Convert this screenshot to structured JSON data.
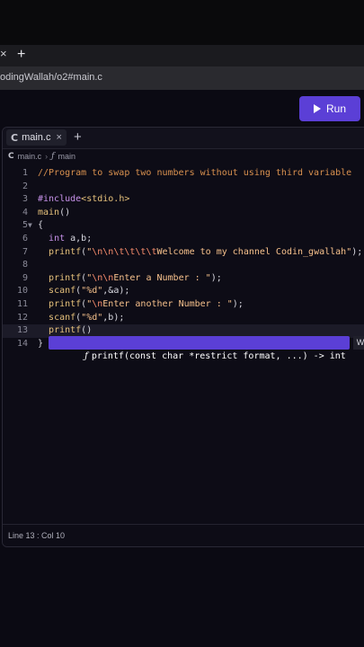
{
  "browser": {
    "close_glyph": "×",
    "new_tab_glyph": "+",
    "url": "odingWallah/o2#main.c"
  },
  "toolbar": {
    "run_label": "Run"
  },
  "editor": {
    "file_tab": {
      "label": "main.c",
      "close": "×",
      "add": "+"
    },
    "breadcrumb": {
      "file": "main.c",
      "separator": "›",
      "symbol": "main"
    },
    "lines": [
      {
        "n": "1",
        "tokens": [
          [
            "cm",
            "//Program to swap two numbers without using third variable"
          ]
        ]
      },
      {
        "n": "2",
        "tokens": []
      },
      {
        "n": "3",
        "tokens": [
          [
            "kw",
            "#include"
          ],
          [
            "inc",
            "<stdio.h>"
          ]
        ]
      },
      {
        "n": "4",
        "tokens": [
          [
            "fn",
            "main"
          ],
          [
            "pl",
            "()"
          ]
        ]
      },
      {
        "n": "5",
        "fold": "▼",
        "tokens": [
          [
            "pl",
            "{"
          ]
        ]
      },
      {
        "n": "6",
        "tokens": [
          [
            "pl",
            "  "
          ],
          [
            "kw",
            "int"
          ],
          [
            "pl",
            " a,b;"
          ]
        ]
      },
      {
        "n": "7",
        "tokens": [
          [
            "pl",
            "  "
          ],
          [
            "fn",
            "printf"
          ],
          [
            "pl",
            "("
          ],
          [
            "str",
            "\""
          ],
          [
            "esc",
            "\\n\\n\\t\\t\\t\\t"
          ],
          [
            "str",
            "Welcome to my channel Codin_gwallah\""
          ],
          [
            "pl",
            ");"
          ]
        ]
      },
      {
        "n": "8",
        "tokens": []
      },
      {
        "n": "9",
        "tokens": [
          [
            "pl",
            "  "
          ],
          [
            "fn",
            "printf"
          ],
          [
            "pl",
            "("
          ],
          [
            "str",
            "\""
          ],
          [
            "esc",
            "\\n\\n"
          ],
          [
            "str",
            "Enter a Number : \""
          ],
          [
            "pl",
            ");"
          ]
        ]
      },
      {
        "n": "10",
        "tokens": [
          [
            "pl",
            "  "
          ],
          [
            "fn",
            "scanf"
          ],
          [
            "pl",
            "("
          ],
          [
            "str",
            "\"%d\""
          ],
          [
            "pl",
            ",&a);"
          ]
        ]
      },
      {
        "n": "11",
        "tokens": [
          [
            "pl",
            "  "
          ],
          [
            "fn",
            "printf"
          ],
          [
            "pl",
            "("
          ],
          [
            "str",
            "\""
          ],
          [
            "esc",
            "\\n"
          ],
          [
            "str",
            "Enter another Number : \""
          ],
          [
            "pl",
            ");"
          ]
        ]
      },
      {
        "n": "12",
        "tokens": [
          [
            "pl",
            "  "
          ],
          [
            "fn",
            "scanf"
          ],
          [
            "pl",
            "("
          ],
          [
            "str",
            "\"%d\""
          ],
          [
            "pl",
            ",b);"
          ]
        ]
      },
      {
        "n": "13",
        "current": true,
        "tokens": [
          [
            "pl",
            "  "
          ],
          [
            "fn",
            "printf"
          ],
          [
            "pl",
            "()"
          ]
        ]
      },
      {
        "n": "14",
        "tokens": [
          [
            "pl",
            "}"
          ]
        ]
      }
    ],
    "hint": {
      "icon": "ƒ",
      "signature": "printf(const char *restrict format, ...) -> int",
      "doc": "Write formatt"
    },
    "status": "Line 13 : Col 10"
  },
  "colors": {
    "accent": "#5b3fd6",
    "background": "#0b0a13"
  }
}
